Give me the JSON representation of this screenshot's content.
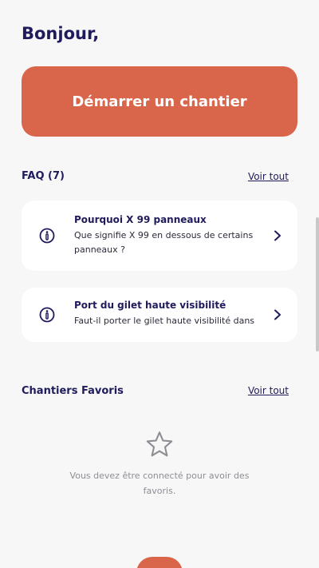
{
  "greeting": "Bonjour,",
  "start_button": {
    "label": "Démarrer un chantier"
  },
  "faq": {
    "title": "FAQ (7)",
    "see_all": "Voir tout",
    "items": [
      {
        "icon": "info-icon",
        "title": "Pourquoi X 99 panneaux",
        "subtitle": "Que signifie X 99 en dessous de certains panneaux ?"
      },
      {
        "icon": "info-icon",
        "title": "Port du gilet haute visibilité",
        "subtitle": "Faut-il porter le gilet haute visibilité dans"
      }
    ]
  },
  "favorites": {
    "title": "Chantiers Favoris",
    "see_all": "Voir tout",
    "empty_icon": "star-icon",
    "empty_message": "Vous devez être connecté pour avoir des favoris."
  },
  "colors": {
    "accent": "#d9664a",
    "primary_text": "#1f1b5c",
    "background": "#f7f7f7",
    "card": "#ffffff",
    "muted": "#8d8d95"
  }
}
